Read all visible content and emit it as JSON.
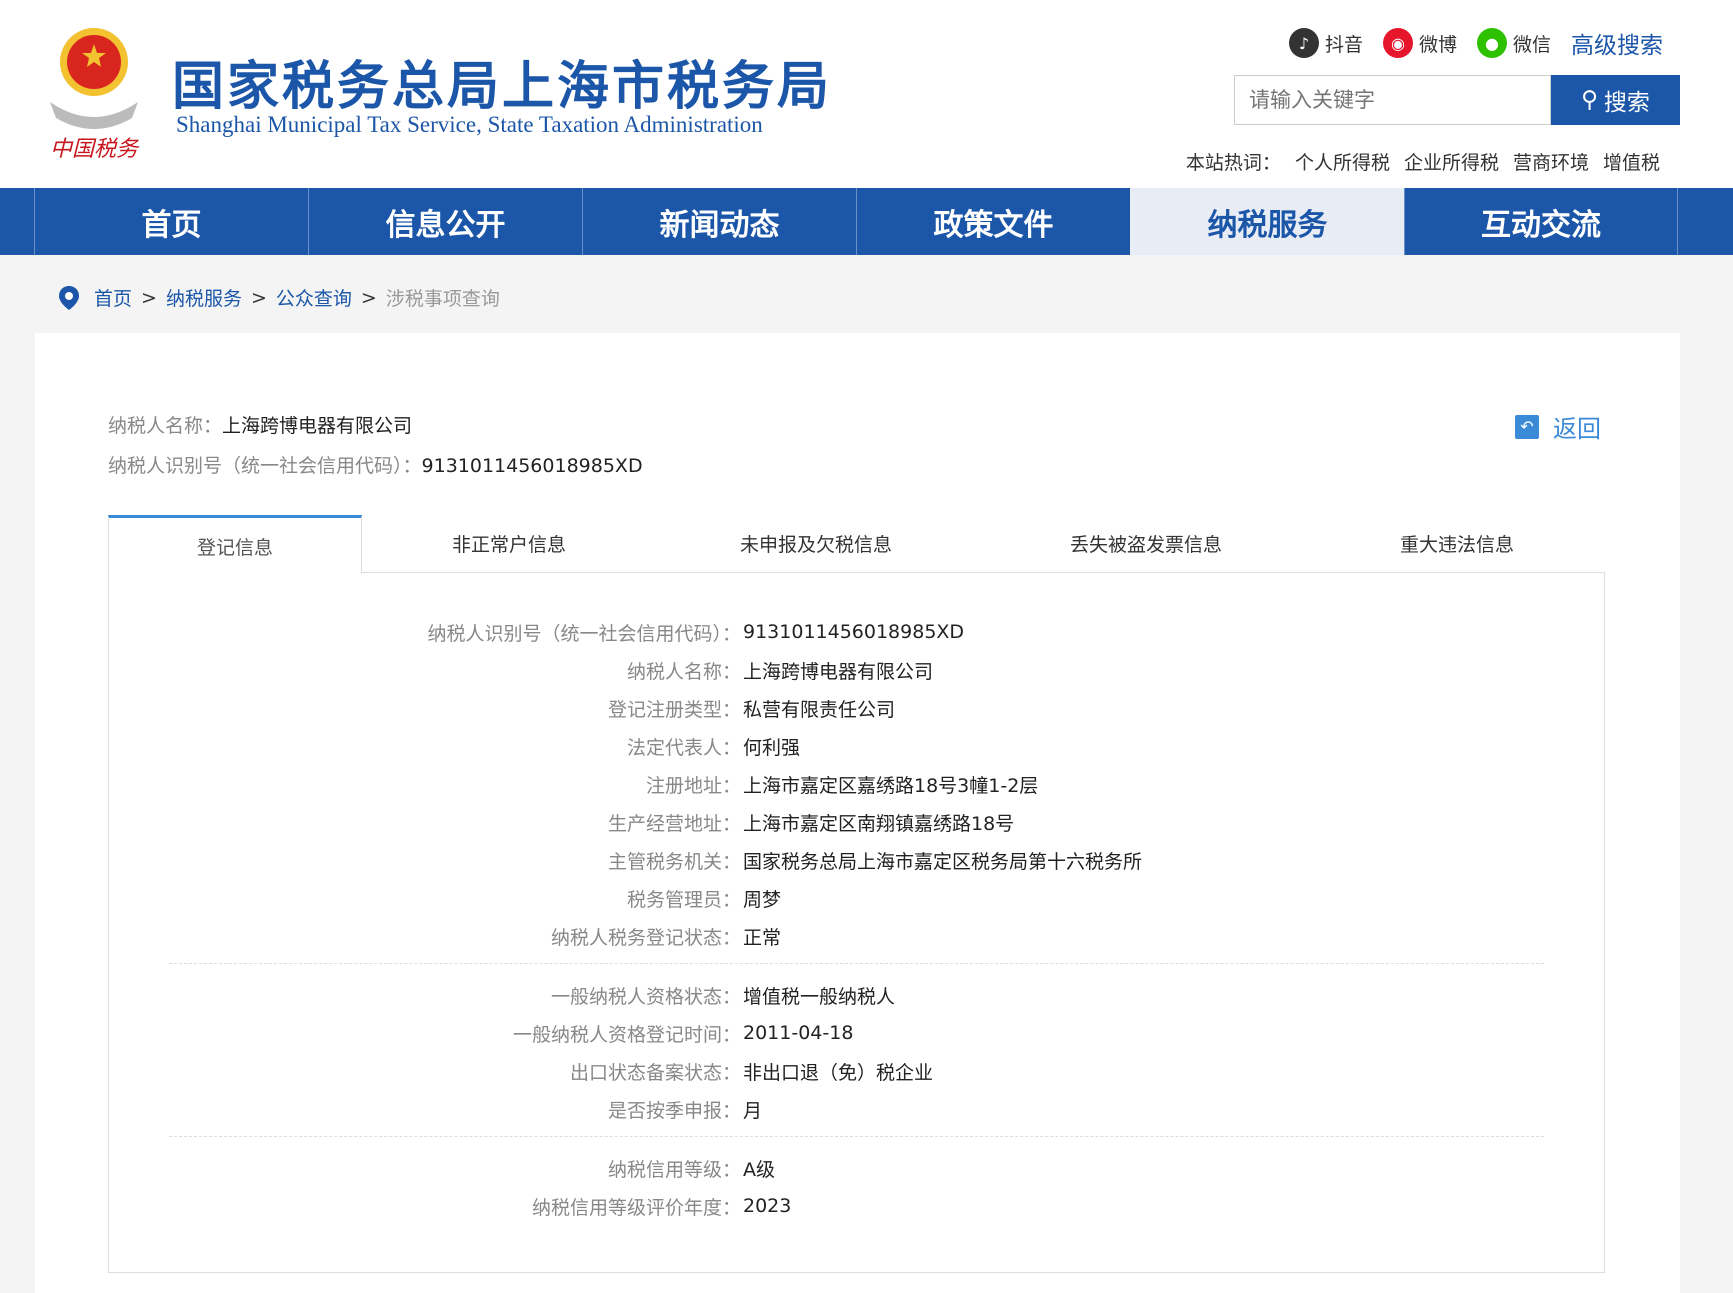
{
  "header": {
    "title_cn": "国家税务总局上海市税务局",
    "title_en": "Shanghai Municipal Tax Service, State Taxation Administration",
    "emblem_text": "中国税务",
    "social": [
      {
        "icon": "douyin-icon",
        "label": "抖音",
        "color": "#333333"
      },
      {
        "icon": "weibo-icon",
        "label": "微博",
        "color": "#e6162d"
      },
      {
        "icon": "wechat-icon",
        "label": "微信",
        "color": "#2dc100"
      }
    ],
    "advanced_search": "高级搜索",
    "search_placeholder": "请输入关键字",
    "search_button": "搜索",
    "hot_label": "本站热词：",
    "hot_words": [
      "个人所得税",
      "企业所得税",
      "营商环境",
      "增值税"
    ]
  },
  "nav": [
    "首页",
    "信息公开",
    "新闻动态",
    "政策文件",
    "纳税服务",
    "互动交流"
  ],
  "nav_active": "纳税服务",
  "breadcrumb": [
    "首页",
    "纳税服务",
    "公众查询",
    "涉税事项查询"
  ],
  "summary": {
    "name_label": "纳税人名称：",
    "name": "上海跨博电器有限公司",
    "id_label": "纳税人识别号（统一社会信用代码）：",
    "id": "9131011456018985XD",
    "back": "返回"
  },
  "tabs": [
    "登记信息",
    "非正常户信息",
    "未申报及欠税信息",
    "丢失被盗发票信息",
    "重大违法信息"
  ],
  "groups": [
    [
      {
        "label": "纳税人识别号（统一社会信用代码）：",
        "value": "9131011456018985XD"
      },
      {
        "label": "纳税人名称：",
        "value": "上海跨博电器有限公司"
      },
      {
        "label": "登记注册类型：",
        "value": "私营有限责任公司"
      },
      {
        "label": "法定代表人：",
        "value": "何利强"
      },
      {
        "label": "注册地址：",
        "value": "上海市嘉定区嘉绣路18号3幢1-2层"
      },
      {
        "label": "生产经营地址：",
        "value": "上海市嘉定区南翔镇嘉绣路18号"
      },
      {
        "label": "主管税务机关：",
        "value": "国家税务总局上海市嘉定区税务局第十六税务所"
      },
      {
        "label": "税务管理员：",
        "value": "周梦"
      },
      {
        "label": "纳税人税务登记状态：",
        "value": "正常"
      }
    ],
    [
      {
        "label": "一般纳税人资格状态：",
        "value": "增值税一般纳税人"
      },
      {
        "label": "一般纳税人资格登记时间：",
        "value": "2011-04-18"
      },
      {
        "label": "出口状态备案状态：",
        "value": "非出口退（免）税企业"
      },
      {
        "label": "是否按季申报：",
        "value": "月"
      }
    ],
    [
      {
        "label": "纳税信用等级：",
        "value": "A级"
      },
      {
        "label": "纳税信用等级评价年度：",
        "value": "2023"
      }
    ]
  ]
}
